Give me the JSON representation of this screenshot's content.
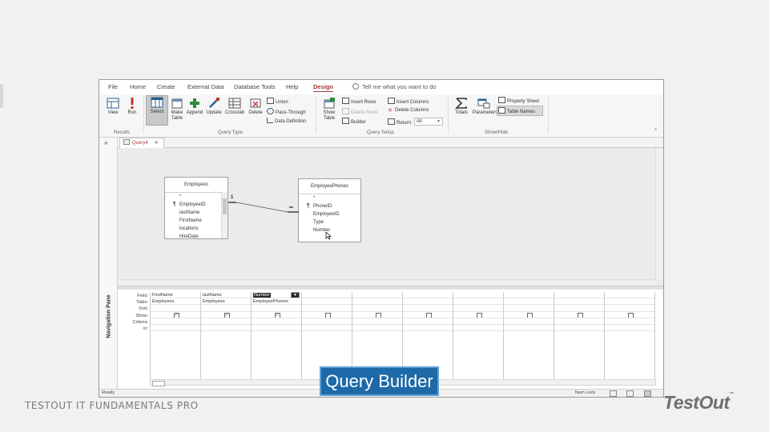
{
  "menu": {
    "items": [
      "File",
      "Home",
      "Create",
      "External Data",
      "Database Tools",
      "Help",
      "Design"
    ],
    "active": "Design",
    "tell_me": "Tell me what you want to do"
  },
  "ribbon": {
    "results": {
      "view": "View",
      "run": "Run",
      "group": "Results"
    },
    "query_type": {
      "select": "Select",
      "make_table": "Make Table",
      "append": "Append",
      "update": "Update",
      "crosstab": "Crosstab",
      "delete": "Delete",
      "union": "Union",
      "pass_through": "Pass-Through",
      "data_definition": "Data Definition",
      "group": "Query Type"
    },
    "query_setup": {
      "show_table": "Show Table",
      "insert_rows": "Insert Rows",
      "delete_rows": "Delete Rows",
      "builder": "Builder",
      "insert_columns": "Insert Columns",
      "delete_columns": "Delete Columns",
      "return_label": "Return:",
      "return_value": "All",
      "group": "Query Setup"
    },
    "show_hide": {
      "totals": "Totals",
      "parameters": "Parameters",
      "property_sheet": "Property Sheet",
      "table_names": "Table Names",
      "group": "Show/Hide"
    }
  },
  "nav_pane": {
    "label": "Navigation Pane",
    "toggle": "»"
  },
  "tab": {
    "name": "Query4",
    "close": "✕"
  },
  "tables": [
    {
      "title": "Employees",
      "fields": [
        "*",
        "EmployeeID",
        "lastName",
        "FirstName",
        "locations",
        "HireDate"
      ],
      "key_index": 1
    },
    {
      "title": "EmployeePhones",
      "fields": [
        "*",
        "PhoneID",
        "EmployeeID",
        "Type",
        "Number"
      ],
      "key_index": 1
    }
  ],
  "relationship": {
    "one": "1",
    "many": "∞"
  },
  "grid": {
    "row_labels": [
      "Field:",
      "Table:",
      "Sort:",
      "Show:",
      "Criteria:",
      "or:"
    ],
    "columns": [
      {
        "field": "FirstName",
        "table": "Employees",
        "show": true
      },
      {
        "field": "lastName",
        "table": "Employees",
        "show": true
      },
      {
        "field": "Number",
        "table": "EmployeePhones",
        "show": true,
        "highlighted": true
      },
      {
        "field": "",
        "table": "",
        "show": false
      },
      {
        "field": "",
        "table": "",
        "show": false
      },
      {
        "field": "",
        "table": "",
        "show": false
      },
      {
        "field": "",
        "table": "",
        "show": false
      },
      {
        "field": "",
        "table": "",
        "show": false
      },
      {
        "field": "",
        "table": "",
        "show": false
      },
      {
        "field": "",
        "table": "",
        "show": false
      }
    ]
  },
  "status": {
    "left": "Ready",
    "num_lock": "Num Lock"
  },
  "overlay": {
    "caption": "Query Builder",
    "footer": "TESTOUT IT FUNDAMENTALS PRO",
    "logo": "TestOut"
  },
  "colors": {
    "accent": "#a4373a",
    "caption_bg": "#1e6aa8",
    "caption_border": "#5ea0d8"
  }
}
